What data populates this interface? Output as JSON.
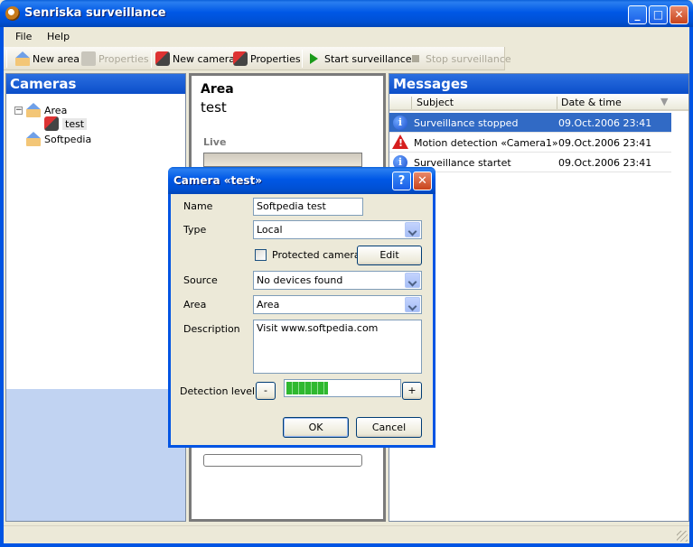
{
  "window": {
    "title": "Senriska surveillance"
  },
  "menu": {
    "file": "File",
    "help": "Help"
  },
  "toolbar": {
    "new_area": "New area",
    "properties_disabled": "Properties",
    "new_camera": "New camera",
    "properties": "Properties",
    "start": "Start surveillance",
    "stop": "Stop surveillance"
  },
  "cameras": {
    "header": "Cameras",
    "tree": [
      {
        "label": "Area"
      },
      {
        "label": "test"
      },
      {
        "label": "Softpedia"
      }
    ]
  },
  "middle": {
    "title": "Area",
    "subtitle": "test",
    "live": "Live"
  },
  "messages": {
    "header": "Messages",
    "columns": {
      "subject": "Subject",
      "datetime": "Date & time"
    },
    "rows": [
      {
        "icon": "info-icon",
        "subject": "Surveillance stopped",
        "datetime": "09.Oct.2006 23:41"
      },
      {
        "icon": "warning-icon",
        "subject": "Motion detection «Camera1»",
        "datetime": "09.Oct.2006 23:41"
      },
      {
        "icon": "info-icon",
        "subject": "Surveillance startet",
        "datetime": "09.Oct.2006 23:41"
      }
    ]
  },
  "dialog": {
    "title": "Camera «test»",
    "name_label": "Name",
    "name_value": "Softpedia test",
    "type_label": "Type",
    "type_value": "Local",
    "protected_label": "Protected camera",
    "protected_checked": false,
    "edit_label": "Edit",
    "source_label": "Source",
    "source_value": "No devices found",
    "area_label": "Area",
    "area_value": "Area",
    "description_label": "Description",
    "description_value": "Visit www.softpedia.com",
    "detection_label": "Detection level",
    "detection_level_fraction": 0.37,
    "minus": "-",
    "plus": "+",
    "ok": "OK",
    "cancel": "Cancel"
  }
}
